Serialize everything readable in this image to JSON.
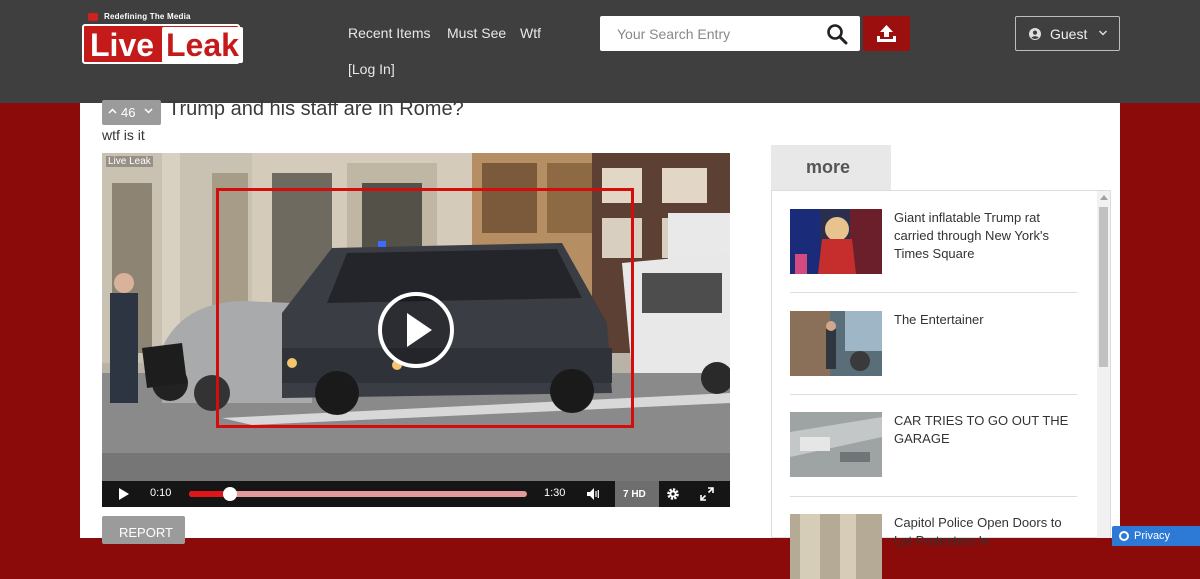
{
  "brand": {
    "tagline": "Redefining The Media",
    "name_part1": "Live",
    "name_part2": "Leak",
    "red": "#c41a1a"
  },
  "nav": {
    "items": [
      "Recent Items",
      "Must See",
      "Wtf",
      "[Log In]"
    ]
  },
  "search": {
    "placeholder": "Your Search Entry",
    "icon": "search-icon"
  },
  "upload": {
    "icon": "upload-icon",
    "color": "#9c0f0f"
  },
  "user": {
    "label": "Guest",
    "icon": "user-circle-icon"
  },
  "post": {
    "vote_count": "46",
    "title": "Trump and his staff are in Rome?",
    "description": "wtf is it",
    "report_label": "REPORT"
  },
  "video": {
    "watermark": "Live Leak",
    "current_time": "0:10",
    "duration": "1:30",
    "progress_fraction": 0.12,
    "quality_label": "7 HD"
  },
  "sidebar": {
    "tab_label": "more",
    "items": [
      {
        "title": "Giant inflatable Trump rat carried through New York's Times Square"
      },
      {
        "title": "The Entertainer"
      },
      {
        "title": "CAR TRIES TO GO OUT THE GARAGE"
      },
      {
        "title": "Capitol Police Open Doors to Let Protesters In"
      }
    ]
  },
  "privacy": {
    "label": "Privacy"
  }
}
